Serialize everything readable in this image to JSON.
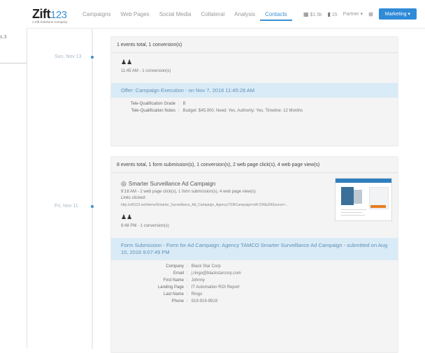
{
  "outer": {
    "fragment": "s.3"
  },
  "brand": {
    "logo_main": "Zift",
    "logo_num": "123",
    "tagline": "A Zift Solutions Company"
  },
  "nav": {
    "items": [
      "Campaigns",
      "Web Pages",
      "Social Media",
      "Collateral",
      "Analysis",
      "Contacts"
    ],
    "active_index": 5,
    "right": {
      "grid_label": "$1.5k",
      "chart_label": "15",
      "partner": "Partner ▾",
      "grid2": "⊞",
      "marketing": "Marketing ▾"
    }
  },
  "timeline": {
    "dates": [
      "Sun, Nov 13",
      "Fri, Nov 11"
    ]
  },
  "card1": {
    "summary": "1 events total, 1 conversion(s)",
    "event_time": "11:45 AM - 1 conversion(s)",
    "subhead": "Offer: Campaign Execution - on Nov 7, 2016 11:45:28 AM",
    "rows": [
      {
        "k": "Tele-Qualification Grade",
        "v": "B"
      },
      {
        "k": "Tele-Qualification Notes",
        "v": "Budget: $45,000, Need: Yes, Authority: Yes, Timeline: 12 Months"
      }
    ]
  },
  "card2": {
    "summary": "8 events total, 1 form submission(s), 1 conversion(s), 2 web page click(s), 4 web page view(s)",
    "campaign_name": "Smarter Surveillance Ad Campaign",
    "campaign_detail": "9:18 AM - 2 web page click(s), 1 form submission(s), 4 web page view(s)",
    "link_clicked": "Links clicked:",
    "url": "http://zift123.net/demo/Smarter_Surveillance_Ad_Campaign_Agency/?ZiftCampaign=zift-234&ZiftSource=...",
    "conv_time": "9:48 PM - 1 conversion(s)",
    "subhead": "Form Submission - Form for Ad Campaign: Agency TAMCO Smarter Surveillance Ad Campaign - submitted on Aug 10, 2016 9:07:49 PM",
    "rows": [
      {
        "k": "Company",
        "v": "Black Star Corp"
      },
      {
        "k": "Email",
        "v": "j.ringo@blackstarcorp.com"
      },
      {
        "k": "First Name",
        "v": "Johnny"
      },
      {
        "k": "Landing Page",
        "v": "IT Automation ROI Report"
      },
      {
        "k": "Last Name",
        "v": "Ringo"
      },
      {
        "k": "Phone",
        "v": "919-919-9919"
      }
    ]
  },
  "icons": {
    "conversion": "people-icon",
    "campaign": "target-icon",
    "grid": "grid-icon",
    "chart": "chart-icon"
  }
}
